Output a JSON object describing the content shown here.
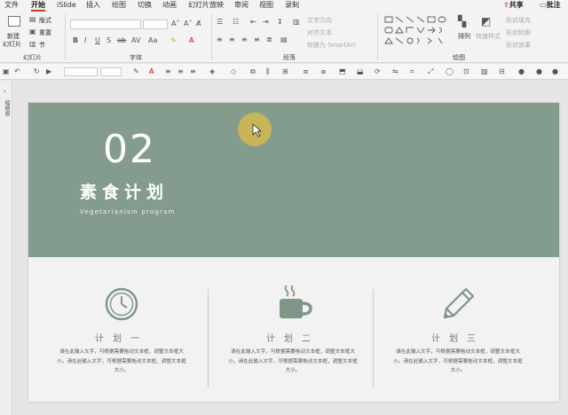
{
  "menu": {
    "items": [
      "文件",
      "开始",
      "iSlide",
      "插入",
      "绘图",
      "切换",
      "动画",
      "幻灯片放映",
      "审阅",
      "视图",
      "录制"
    ],
    "share": "共享",
    "comment": "批注"
  },
  "ribbon": {
    "slides": {
      "new_line1": "新建",
      "new_line2": "幻灯片",
      "layout": "版式",
      "reset": "重置",
      "section": "节",
      "label": "幻灯片"
    },
    "font": {
      "label": "字体"
    },
    "paragraph": {
      "text_direction": "文字方向",
      "align_text": "对齐文本",
      "smartart": "转换为 SmartArt",
      "label": "段落"
    },
    "drawing": {
      "arrange": "排列",
      "quick_styles": "快速样式",
      "fill": "形状填充",
      "outline": "形状轮廓",
      "effects": "形状效果",
      "label": "绘图"
    }
  },
  "left_pane": {
    "label": "缩略图"
  },
  "slide": {
    "number": "02",
    "title": "素食计划",
    "subtitle": "Vegetarianism program",
    "columns": [
      {
        "icon": "clock-icon",
        "title": "计划一",
        "body": "请在此输入文字，可根据需要拖动文本框，调整文本框大小。请在此输入文字，可根据需要拖动文本框，调整文本框大小。"
      },
      {
        "icon": "coffee-cup-icon",
        "title": "计划二",
        "body": "请在此输入文字，可根据需要拖动文本框，调整文本框大小。请在此输入文字，可根据需要拖动文本框，调整文本框大小。"
      },
      {
        "icon": "pencil-icon",
        "title": "计划三",
        "body": "请在此输入文字，可根据需要拖动文本框，调整文本框大小。请在此输入文字，可根据需要拖动文本框，调整文本框大小。"
      }
    ]
  },
  "colors": {
    "header_green": "#849c8d",
    "accent": "#c43e1c",
    "icon_green": "#7f9586"
  }
}
